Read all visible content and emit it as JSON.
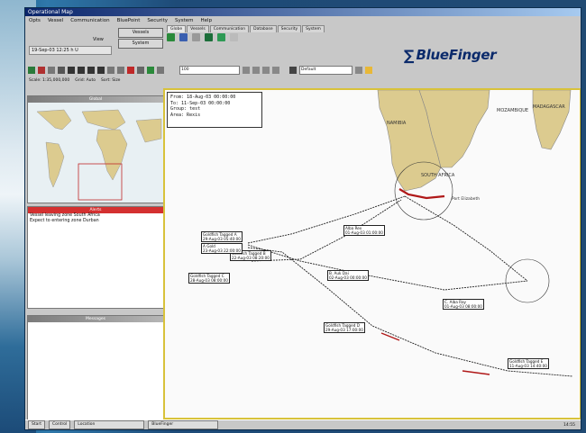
{
  "window": {
    "title": "Operational Map"
  },
  "menu": [
    "Opts",
    "Vessel",
    "Communication",
    "BluePoint",
    "Security",
    "System",
    "Help"
  ],
  "user": {
    "field": "19-Sep-03 12:25 h U"
  },
  "panel_label": "View",
  "buttons": {
    "vessels": "Vessels",
    "system": "System"
  },
  "tabs": [
    "Globe",
    "Vessels",
    "Communication",
    "Database",
    "Security",
    "System"
  ],
  "logo": {
    "text": "BlueFinger"
  },
  "toolbar": {
    "scale_value": "100",
    "zoom_combo": "Default"
  },
  "status": {
    "scale": "Scale: 1:35,000,000",
    "grid": "Grid: Auto",
    "info": "Sort: Size"
  },
  "sidebar": {
    "map_header": "Global",
    "alerts_header": "Alerts",
    "alerts": [
      "Vessel leaving zone South Africa",
      "Expect to entering zone Durban"
    ],
    "messages_header": "Messages"
  },
  "info_box": {
    "from": "From: 18-Aug-03 00:00:00",
    "to": "To:   11-Sep-03 00:00:00",
    "group": "Group: test",
    "area": "Area: Rexis"
  },
  "map_labels": {
    "namibia": "NAMIBIA",
    "south_africa": "SOUTH AFRICA",
    "mozambique": "MOZAMBIQUE",
    "madagascar": "MADAGASCAR",
    "port_elizabeth": "Port Elizabeth"
  },
  "vessel_labels": [
    {
      "name": "Goldfish Tagged A",
      "time": "29-Aug-03 05:40:00"
    },
    {
      "name": "Goldfish Tagged B",
      "time": "22-Aug-03 08:20:00"
    },
    {
      "name": "A Gold",
      "time": "23-Aug-03 22:00:00"
    },
    {
      "name": "Alba Rex",
      "time": "01-Aug-03 01:00:00"
    },
    {
      "name": "Goldfish Tagged C",
      "time": "28-Aug-03 08:00:00"
    },
    {
      "name": "B. Auk Dai",
      "time": "02-Aug-03 00:00:00"
    },
    {
      "name": "C. Alba Ray",
      "time": "01-Aug-03 08:00:00"
    },
    {
      "name": "Goldfish Tagged D",
      "time": "29-Aug-03 17:00:00"
    },
    {
      "name": "Goldfish Tagged E",
      "time": "11-Aug-03 14:40:00"
    }
  ],
  "taskbar": {
    "start": "Start",
    "items": [
      "Control",
      "Location",
      "BlueFinger"
    ],
    "clock": "14:55"
  },
  "colors": {
    "title_bar": "#0a246a",
    "alert_header": "#d43030",
    "map_border": "#d8c23a",
    "track": "#222222",
    "track_red": "#b01818"
  }
}
